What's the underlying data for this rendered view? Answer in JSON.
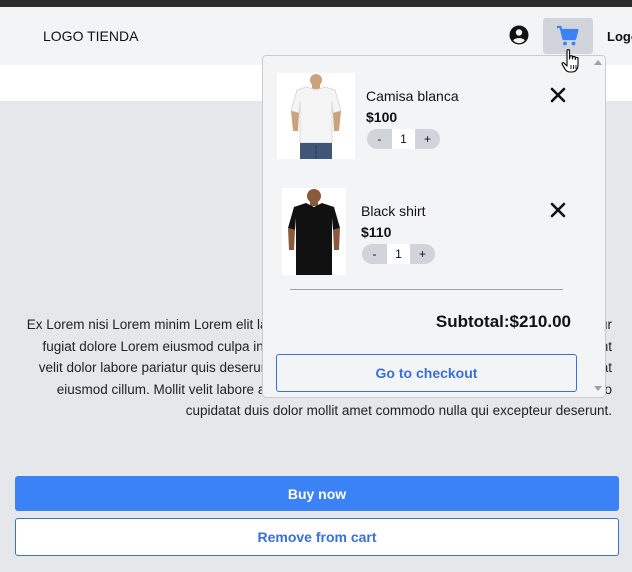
{
  "header": {
    "logo_text": "LOGO TIENDA",
    "login_text": "Logo",
    "user_icon": "user-circle-icon",
    "cart_icon": "shopping-cart-icon"
  },
  "product": {
    "description": "Ex Lorem nisi Lorem minim Lorem elit laborum tempor aliqua. Consequat elit amet aute excepteur fugiat dolore Lorem eiusmod culpa in nostrud nisi mollit do ullamco culpa consectetur fugiat sint velit dolor labore pariatur quis deserunt excepteur eu est sit ea occaecat. Lorem cillum cupidatat eiusmod cillum. Mollit velit labore anim sint laborum velit fugiat esse nulla excepteur. Ullamco cupidatat duis dolor mollit amet commodo nulla qui excepteur deserunt.",
    "buy_label": "Buy now",
    "remove_label": "Remove from cart"
  },
  "cart": {
    "items": [
      {
        "name": "Camisa blanca",
        "price": "$100",
        "qty": "1",
        "minus": "-",
        "plus": "+",
        "shirt_color": "#f5f5f5"
      },
      {
        "name": "Black shirt",
        "price": "$110",
        "qty": "1",
        "minus": "-",
        "plus": "+",
        "shirt_color": "#111111"
      }
    ],
    "subtotal": "Subtotal:$210.00",
    "checkout_label": "Go to checkout",
    "remove_icon": "close-icon"
  },
  "colors": {
    "accent": "#3b82f6",
    "outline": "#3b6fd8",
    "navbar": "#f3f4f6",
    "page_bg": "#e5e7eb"
  }
}
